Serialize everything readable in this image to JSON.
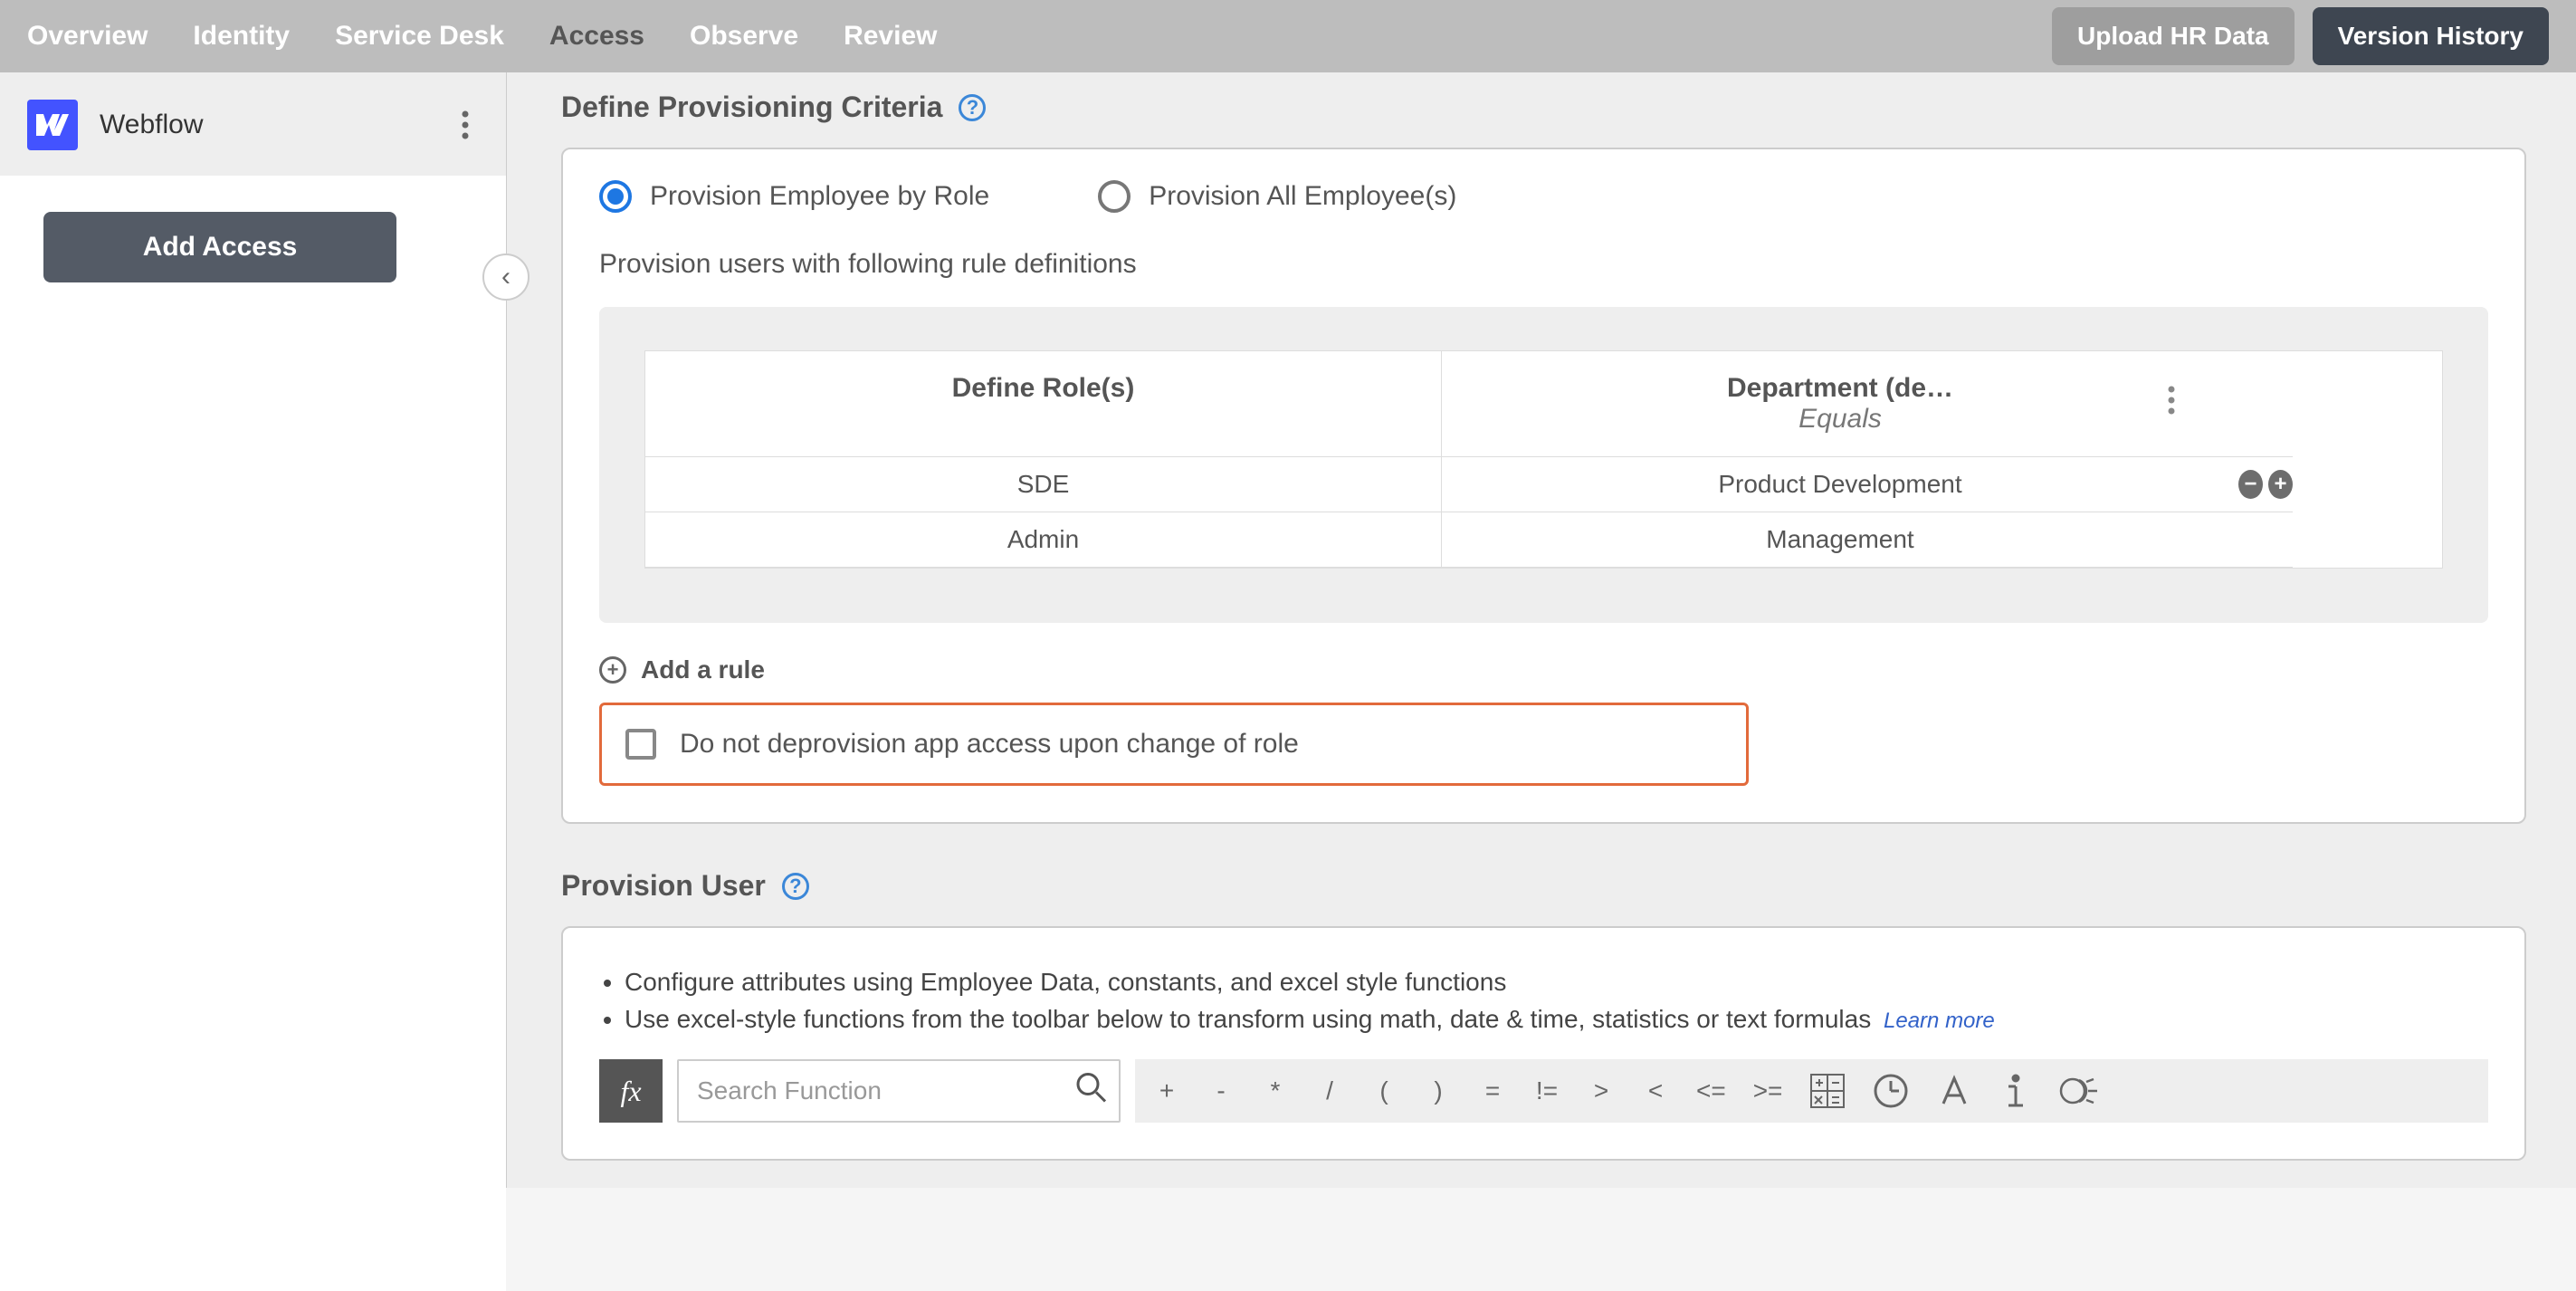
{
  "topnav": {
    "tabs": [
      "Overview",
      "Identity",
      "Service Desk",
      "Access",
      "Observe",
      "Review"
    ],
    "activeIndex": 3,
    "uploadBtn": "Upload HR Data",
    "versionBtn": "Version History"
  },
  "sidebar": {
    "appName": "Webflow",
    "addAccess": "Add Access"
  },
  "criteria": {
    "title": "Define Provisioning Criteria",
    "radioByRole": "Provision Employee by Role",
    "radioAll": "Provision All Employee(s)",
    "subhead": "Provision users with following rule definitions",
    "table": {
      "col1": "Define Role(s)",
      "col2": "Department (de…",
      "col2Sub": "Equals",
      "rows": [
        {
          "role": "SDE",
          "dept": "Product Development"
        },
        {
          "role": "Admin",
          "dept": "Management"
        }
      ]
    },
    "addRule": "Add a rule",
    "noDeprov": "Do not deprovision app access upon change of role"
  },
  "provUser": {
    "title": "Provision User",
    "bullet1": "Configure attributes using Employee Data, constants, and excel style functions",
    "bullet2": "Use excel-style functions from the toolbar below to transform using math, date & time, statistics or text formulas",
    "learnMore": "Learn more",
    "fxLabel": "fx",
    "searchPlaceholder": "Search Function",
    "ops": [
      "+",
      "-",
      "*",
      "/",
      "(",
      ")",
      "=",
      "!=",
      ">",
      "<",
      "<=",
      ">="
    ]
  }
}
